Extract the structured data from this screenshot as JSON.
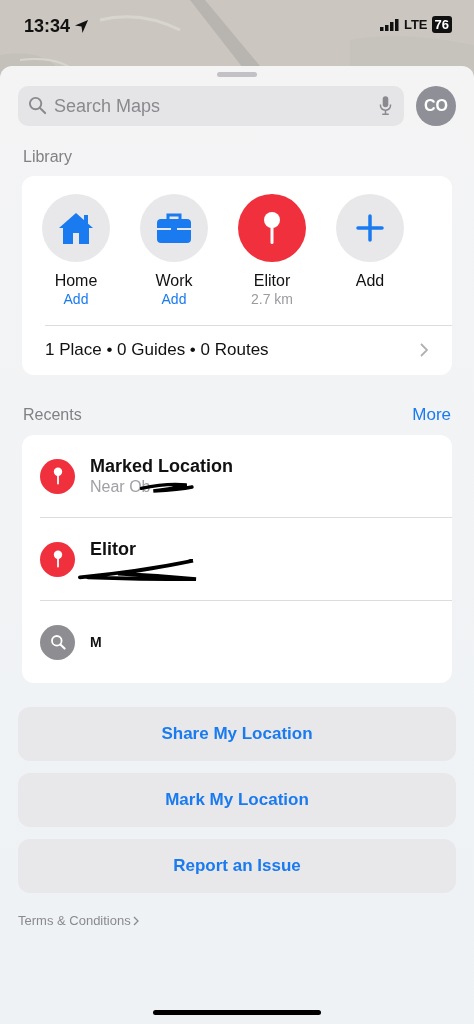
{
  "status_bar": {
    "time": "13:34",
    "network": "LTE",
    "battery": "76"
  },
  "search": {
    "placeholder": "Search Maps",
    "avatar": "CO"
  },
  "library": {
    "title": "Library",
    "items": [
      {
        "kind": "home",
        "label": "Home",
        "subtitle": "Add"
      },
      {
        "kind": "work",
        "label": "Work",
        "subtitle": "Add"
      },
      {
        "kind": "pin",
        "label": "Elitor",
        "subtitle": "2.7 km"
      },
      {
        "kind": "add",
        "label": "Add"
      }
    ],
    "summary": "1 Place • 0 Guides • 0 Routes"
  },
  "recents": {
    "title": "Recents",
    "more": "More",
    "items": [
      {
        "kind": "pin",
        "title": "Marked Location",
        "subtitle": "Near Ob",
        "redacted": true
      },
      {
        "kind": "pin",
        "title": "Elitor",
        "redacted": true
      },
      {
        "kind": "search",
        "title": "M",
        "redacted": false
      }
    ]
  },
  "actions": [
    "Share My Location",
    "Mark My Location",
    "Report an Issue"
  ],
  "terms": "Terms & Conditions"
}
